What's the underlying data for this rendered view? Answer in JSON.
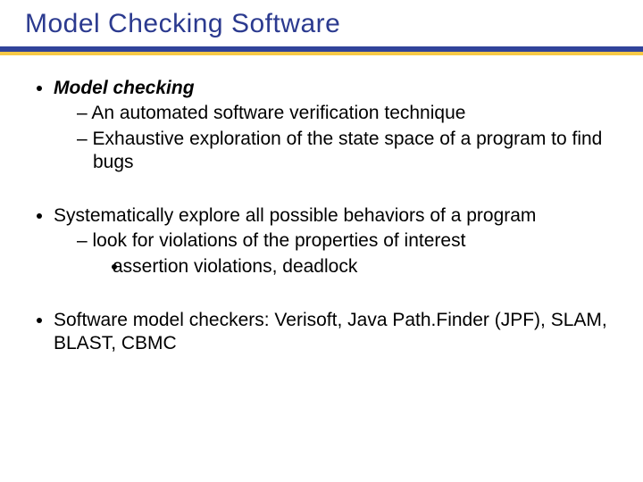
{
  "title": "Model Checking Software",
  "blocks": [
    {
      "lead": "Model checking",
      "lead_em": true,
      "sub": [
        "An automated software verification technique",
        "Exhaustive exploration of the state space of a program to find bugs"
      ]
    },
    {
      "lead": "Systematically explore all possible behaviors of a program",
      "lead_em": false,
      "sub": [
        "look for violations of the properties of interest"
      ],
      "subsub": [
        "assertion violations, deadlock"
      ]
    },
    {
      "lead": "Software model checkers: Verisoft, Java Path.Finder (JPF), SLAM, BLAST, CBMC",
      "lead_em": false,
      "sub": []
    }
  ]
}
